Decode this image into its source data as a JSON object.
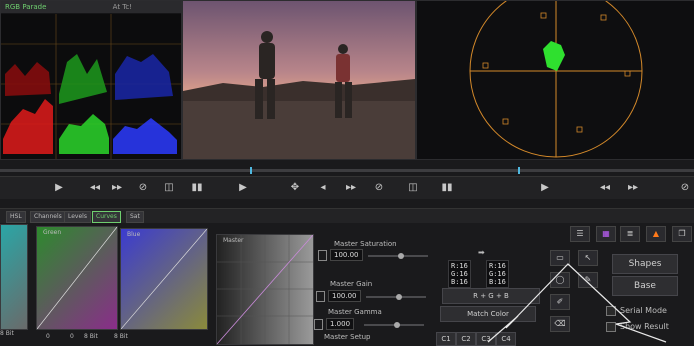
{
  "scopes": {
    "parade_tab": "RGB Parade",
    "second_tab": "At Tc!"
  },
  "top_controls": {
    "transport_icons": [
      "play-icon",
      "prev-icon",
      "next-icon",
      "bypass-icon"
    ]
  },
  "palette_tabs": [
    {
      "label": "HSL",
      "active": false
    },
    {
      "label": "Channels",
      "active": false
    },
    {
      "label": "Levels",
      "active": false
    },
    {
      "label": "Curves",
      "active": true
    },
    {
      "label": "Sat",
      "active": false
    }
  ],
  "curves": {
    "green_label": "Green",
    "blue_label": "Blue",
    "master_label": "Master",
    "bit_label_a": "8 Bit",
    "bit_label_b": "8 Bit",
    "bit_label_c": "8 Bit",
    "zero_a": "0",
    "zero_b": "0"
  },
  "master": {
    "saturation_label": "Master Saturation",
    "saturation_value": "100.00",
    "gain_label": "Master Gain",
    "gain_value": "100.00",
    "gamma_label": "Master Gamma",
    "gamma_value": "1.000",
    "setup_label": "Master Setup"
  },
  "readout": {
    "left": [
      "R:16",
      "G:16",
      "B:16"
    ],
    "right": [
      "R:16",
      "G:16",
      "B:16"
    ]
  },
  "buttons": {
    "rgb": "R + G + B",
    "match_color": "Match Color",
    "c1": "C1",
    "c2": "C2",
    "c3": "C3",
    "c4": "C4",
    "shapes": "Shapes",
    "base": "Base",
    "serial_mode": "Serial Mode",
    "show_result": "Show Result"
  },
  "colors": {
    "accent_green": "#6fcf6f",
    "vectorscope": "#d4892a",
    "warning": "#ff7a1a"
  }
}
